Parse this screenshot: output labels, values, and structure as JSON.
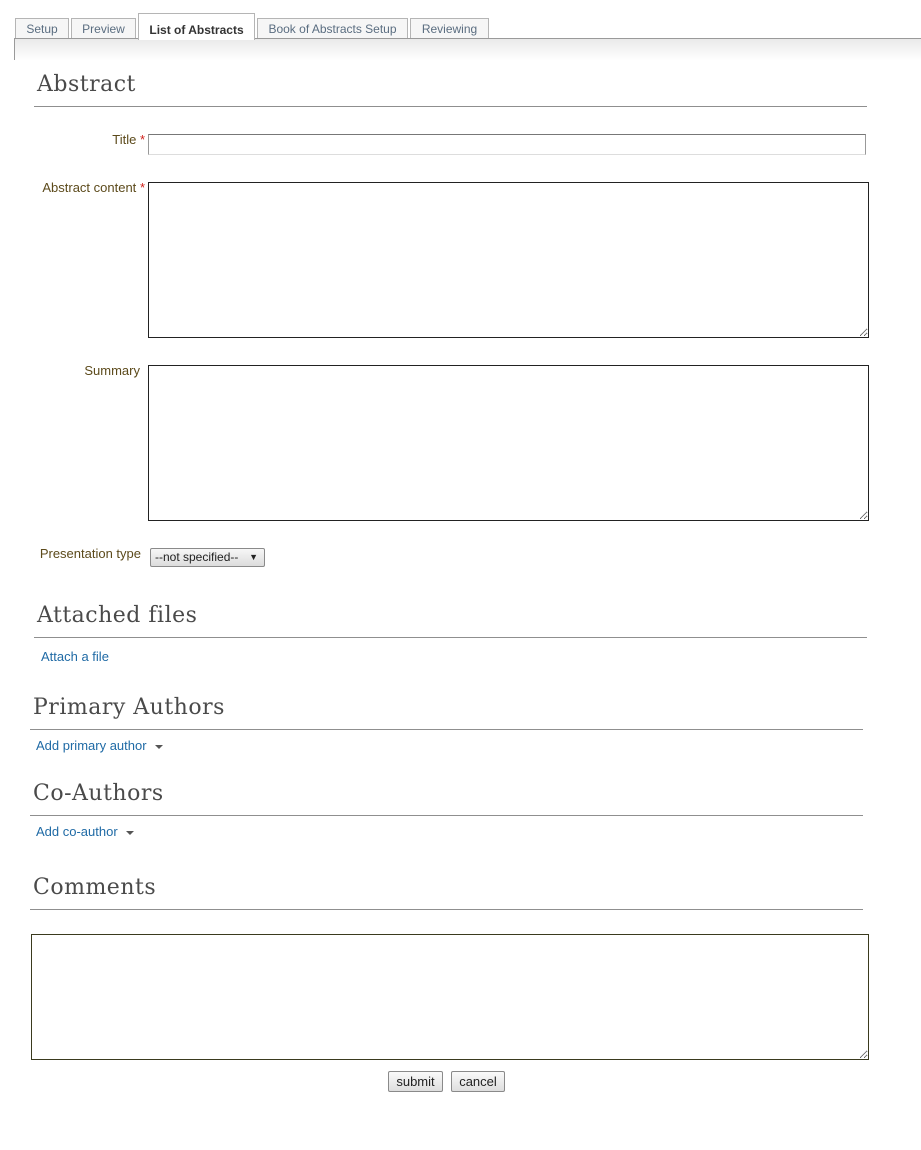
{
  "tabs": [
    {
      "label": "Setup"
    },
    {
      "label": "Preview"
    },
    {
      "label": "List of Abstracts",
      "active": true
    },
    {
      "label": "Book of Abstracts Setup"
    },
    {
      "label": "Reviewing"
    }
  ],
  "abstract_section": {
    "heading": "Abstract",
    "title_label": "Title",
    "title_value": "",
    "content_label": "Abstract content",
    "content_value": "",
    "summary_label": "Summary",
    "summary_value": "",
    "presentation_type_label": "Presentation type",
    "presentation_type_selected": "--not specified--",
    "required_marker": "*"
  },
  "attached_files": {
    "heading": "Attached files",
    "attach_link": "Attach a file"
  },
  "primary_authors": {
    "heading": "Primary Authors",
    "add_link": "Add primary author"
  },
  "co_authors": {
    "heading": "Co-Authors",
    "add_link": "Add co-author"
  },
  "comments": {
    "heading": "Comments",
    "value": ""
  },
  "actions": {
    "submit": "submit",
    "cancel": "cancel"
  },
  "colors": {
    "link": "#1f6aa5",
    "label": "#5c4a1b",
    "required": "#d0201a",
    "heading": "#4a4a4a"
  }
}
